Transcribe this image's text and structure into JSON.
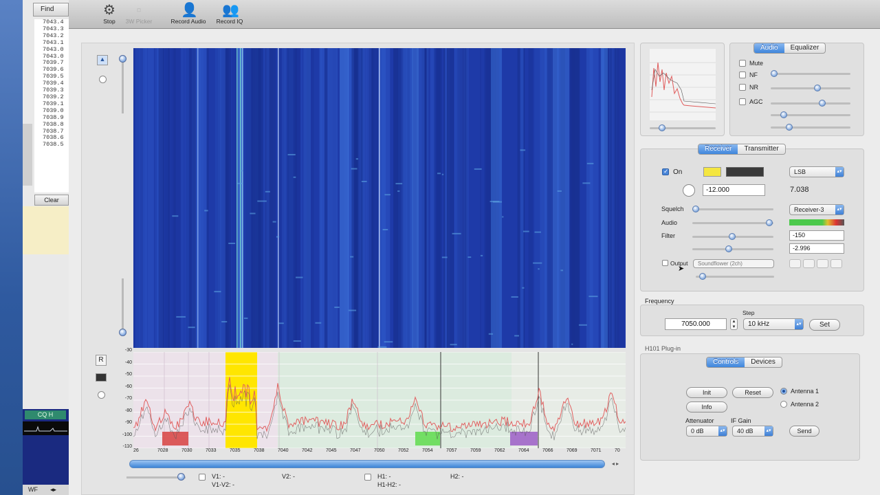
{
  "background_window": {
    "find_label": "Find",
    "frequency_list": [
      "7043.4",
      "7043.3",
      "7043.2",
      "7043.1",
      "7043.0",
      "7043.0",
      "7039.7",
      "7039.6",
      "7039.5",
      "7039.4",
      "7039.3",
      "7039.2",
      "7039.1",
      "7039.0",
      "7038.9",
      "7038.8",
      "7038.7",
      "7038.6",
      "7038.5"
    ],
    "clear_label": "Clear",
    "cq_label": "CQ H",
    "wf_label": "WF"
  },
  "toolbar": {
    "stop_label": "Stop",
    "picker_label": "3W Picker",
    "record_audio_label": "Record Audio",
    "record_iq_label": "Record IQ"
  },
  "waterfall": {
    "r_label": "R",
    "y_ticks": [
      "-30",
      "-40",
      "-50",
      "-60",
      "-70",
      "-80",
      "-90",
      "-100",
      "-110"
    ],
    "x_ticks": [
      "26",
      "7028",
      "7030",
      "7033",
      "7035",
      "7038",
      "7040",
      "7042",
      "7045",
      "7047",
      "7050",
      "7052",
      "7054",
      "7057",
      "7059",
      "7062",
      "7064",
      "7066",
      "7069",
      "7071",
      "70"
    ],
    "v1_label": "V1: -",
    "v1v2_label": "V1-V2: -",
    "v2_label": "V2: -",
    "h1_label": "H1: -",
    "h1h2_label": "H1-H2: -",
    "h2_label": "H2: -",
    "scroll_arrows": "◂ ▸"
  },
  "audio_panel": {
    "tab_audio": "Audio",
    "tab_equalizer": "Equalizer",
    "mute_label": "Mute",
    "nf_label": "NF",
    "nr_label": "NR",
    "agc_label": "AGC"
  },
  "receiver_panel": {
    "tab_receiver": "Receiver",
    "tab_transmitter": "Transmitter",
    "on_label": "On",
    "mode_value": "LSB",
    "offset_value": "-12.000",
    "freq_readout": "7.038",
    "squelch_label": "Squelch",
    "receiver_select": "Receiver-3",
    "audio_label": "Audio",
    "filter_label": "Filter",
    "filter_low": "-150",
    "filter_high": "-2.996",
    "output_label": "Output",
    "output_device": "Soundflower (2ch)"
  },
  "frequency_panel": {
    "title": "Frequency",
    "step_label": "Step",
    "frequency_value": "7050.000",
    "step_value": "10 kHz",
    "set_label": "Set"
  },
  "plugin_panel": {
    "title": "H101 Plug-in",
    "tab_controls": "Controls",
    "tab_devices": "Devices",
    "init_label": "Init",
    "reset_label": "Reset",
    "info_label": "Info",
    "antenna1_label": "Antenna 1",
    "antenna2_label": "Antenna 2",
    "attenuator_label": "Attenuator",
    "attenuator_value": "0 dB",
    "ifgain_label": "IF Gain",
    "ifgain_value": "40 dB",
    "send_label": "Send"
  },
  "colors": {
    "waterfall_base": "#1e3aa8",
    "spectrum_trace": "#e06060",
    "highlight_yellow": "#ffe600",
    "marker_red": "#d94a4a",
    "marker_green": "#66dd55",
    "marker_purple": "#a066c8"
  },
  "levels": {
    "squelch": 0.05,
    "audio": 0.95,
    "filter_low": 0.5,
    "filter_high": 0.45,
    "nf": 0.05,
    "nr": 0.6,
    "agc": 0.6
  }
}
